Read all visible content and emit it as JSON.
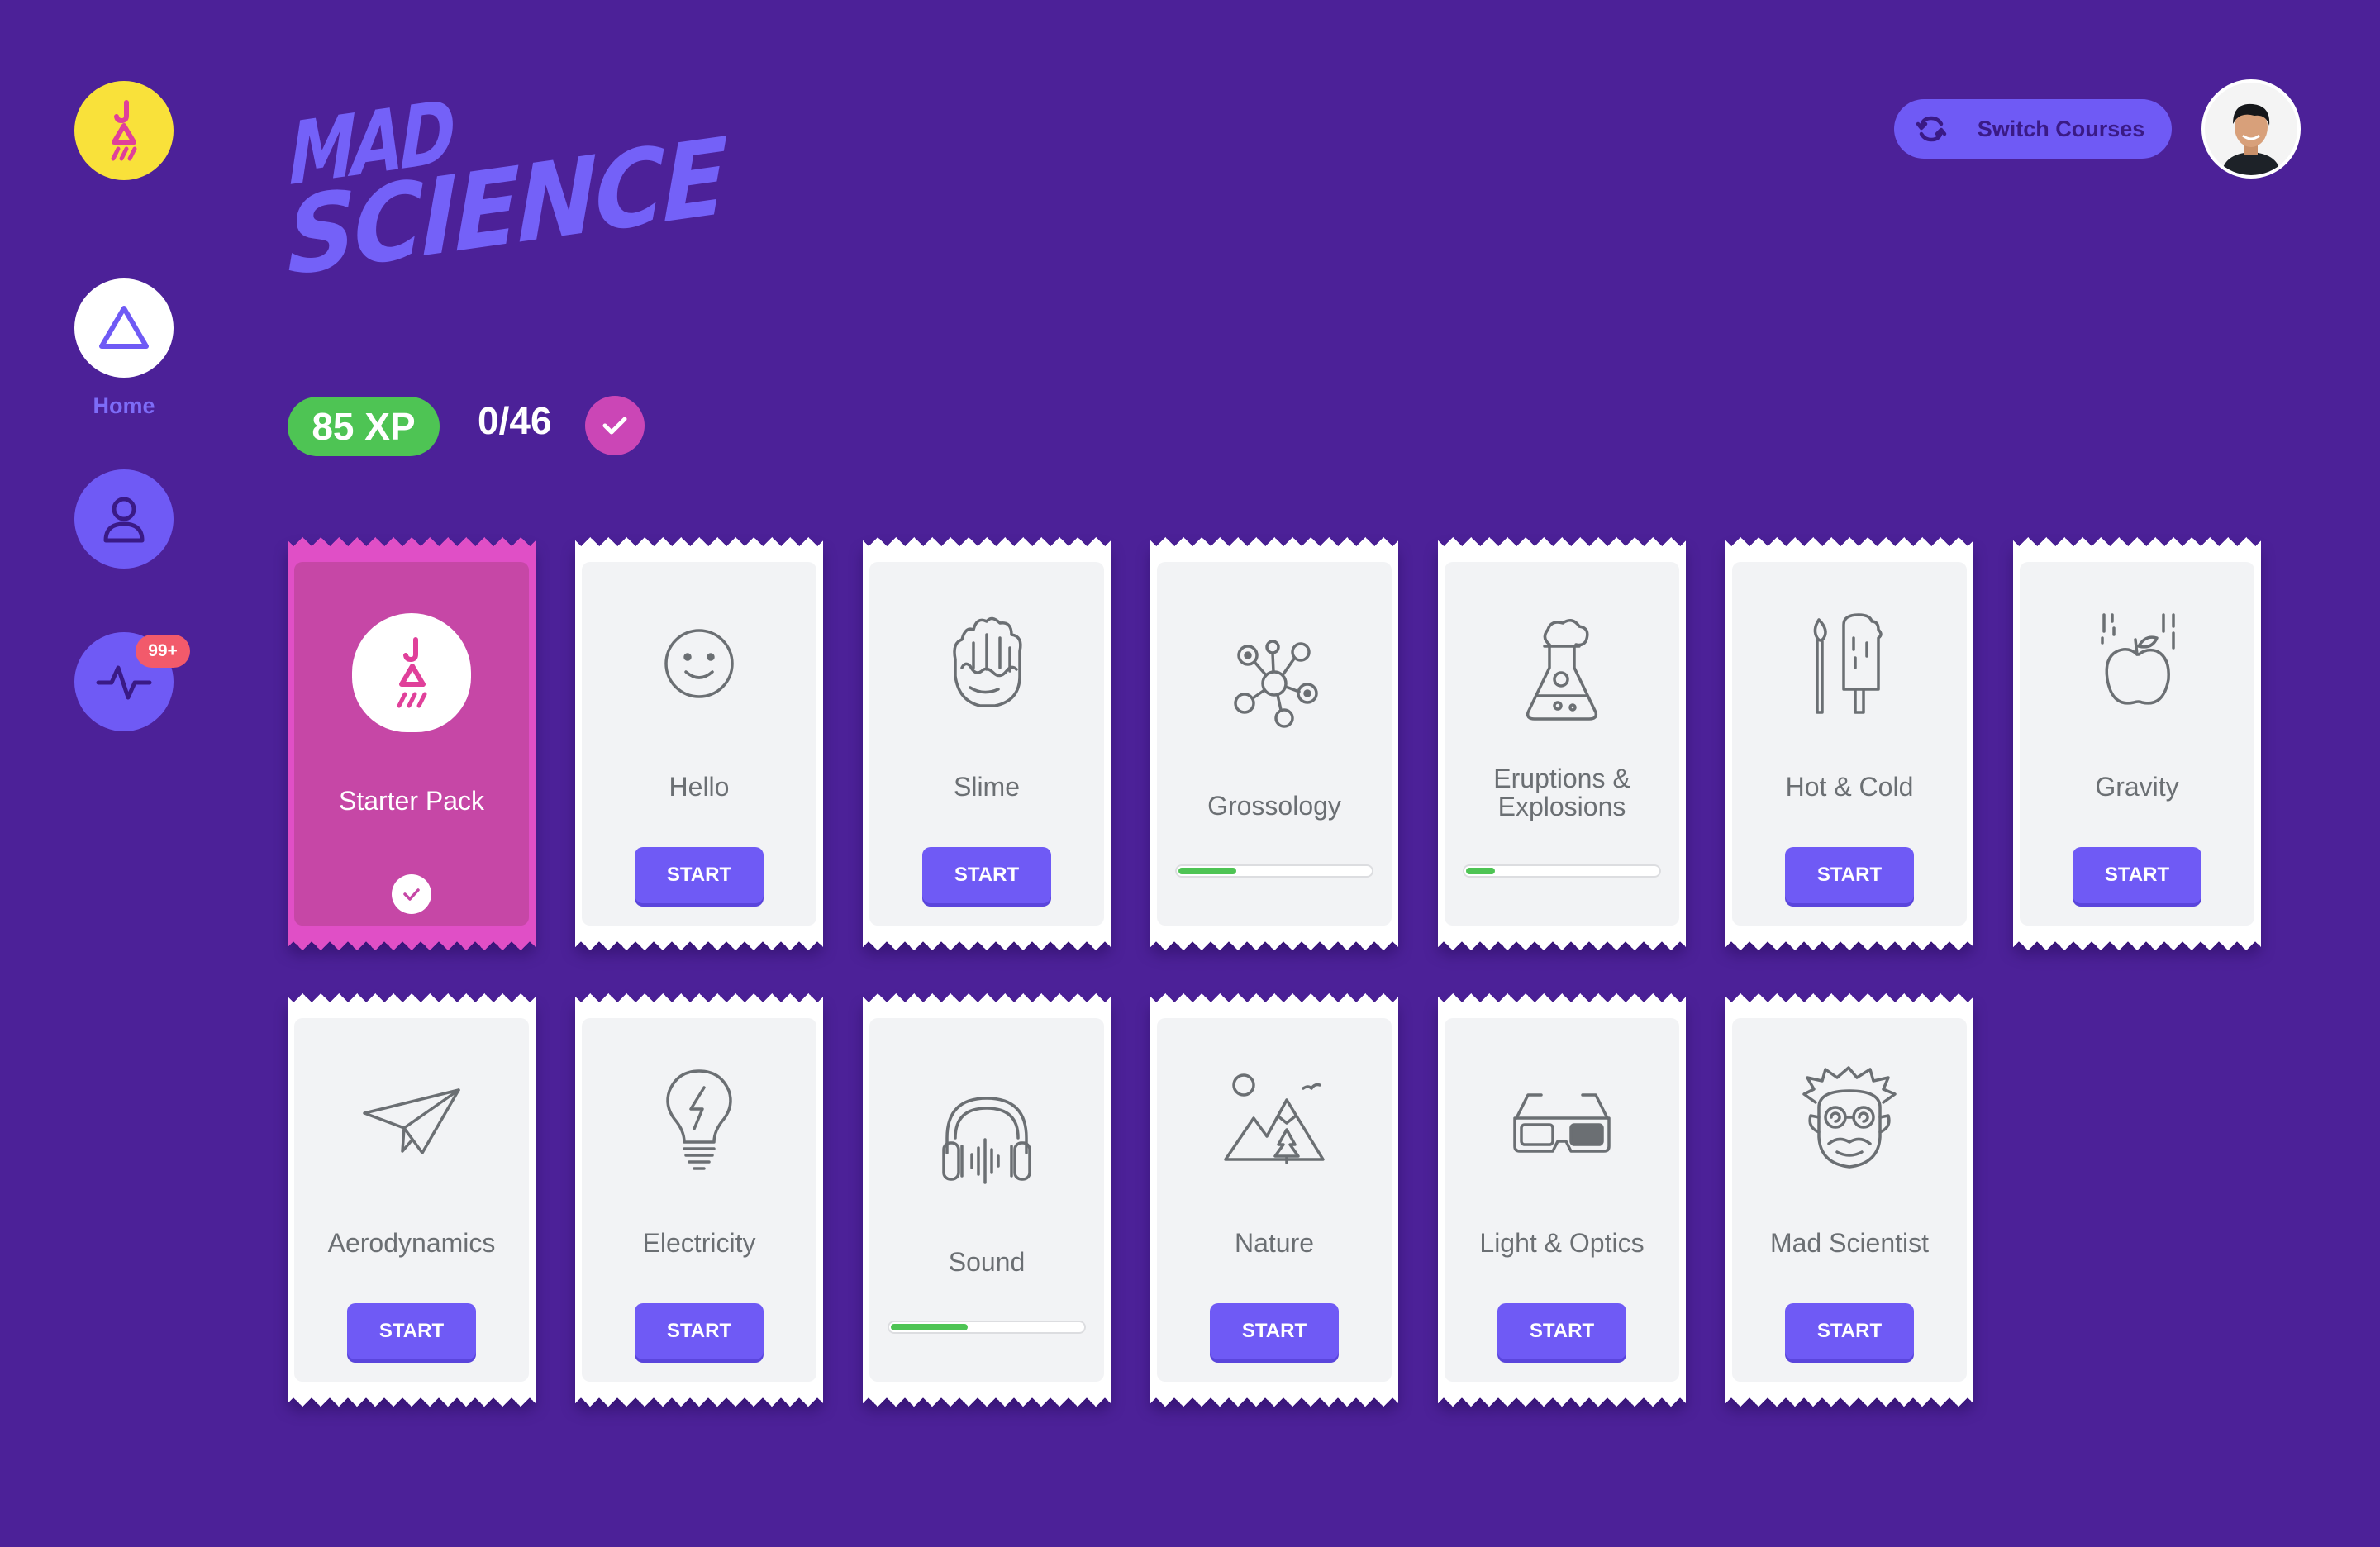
{
  "sidebar": {
    "home_label": "Home",
    "notification_count": "99+"
  },
  "header": {
    "title_line1": "MAD",
    "title_line2": "SCIENCE",
    "switch_courses_label": "Switch Courses"
  },
  "stats": {
    "xp": "85 XP",
    "completed": "0/46"
  },
  "colors": {
    "background": "#4c2198",
    "accent": "#6f5af5",
    "xp_green": "#4ec454",
    "completed_pink": "#cb46b6",
    "logo_yellow": "#f9e13a"
  },
  "cards": [
    {
      "label": "Starter Pack",
      "icon": "starter-logo-icon",
      "state": "completed"
    },
    {
      "label": "Hello",
      "icon": "smiley-icon",
      "state": "start",
      "button": "START"
    },
    {
      "label": "Slime",
      "icon": "slime-hand-icon",
      "state": "start",
      "button": "START"
    },
    {
      "label": "Grossology",
      "icon": "germ-icon",
      "state": "in-progress",
      "progress": 0.3
    },
    {
      "label": "Eruptions & Explosions",
      "icon": "flask-icon",
      "state": "in-progress",
      "progress": 0.15
    },
    {
      "label": "Hot & Cold",
      "icon": "match-popsicle-icon",
      "state": "start",
      "button": "START"
    },
    {
      "label": "Gravity",
      "icon": "falling-apple-icon",
      "state": "start",
      "button": "START"
    },
    {
      "label": "Aerodynamics",
      "icon": "paper-plane-icon",
      "state": "start",
      "button": "START"
    },
    {
      "label": "Electricity",
      "icon": "light-bulb-icon",
      "state": "start",
      "button": "START"
    },
    {
      "label": "Sound",
      "icon": "headphones-icon",
      "state": "in-progress",
      "progress": 0.4
    },
    {
      "label": "Nature",
      "icon": "mountain-icon",
      "state": "start",
      "button": "START"
    },
    {
      "label": "Light & Optics",
      "icon": "3d-glasses-icon",
      "state": "start",
      "button": "START"
    },
    {
      "label": "Mad Scientist",
      "icon": "mad-scientist-icon",
      "state": "start",
      "button": "START"
    }
  ]
}
